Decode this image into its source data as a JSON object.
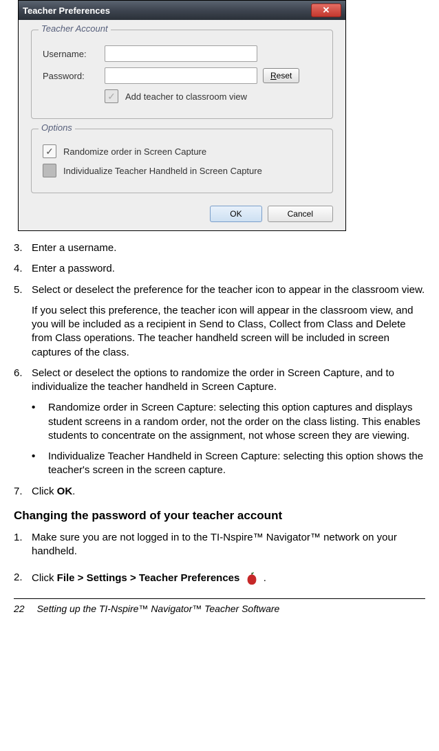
{
  "dialog": {
    "title": "Teacher Preferences",
    "group1": {
      "legend": "Teacher Account",
      "username_label": "Username:",
      "password_label": "Password:",
      "reset_label": "Reset",
      "add_teacher_label": "Add teacher to classroom view"
    },
    "group2": {
      "legend": "Options",
      "opt1": "Randomize order in Screen Capture",
      "opt2": "Individualize Teacher Handheld in Screen Capture"
    },
    "ok": "OK",
    "cancel": "Cancel"
  },
  "steps": {
    "s3": {
      "n": "3.",
      "t": "Enter a username."
    },
    "s4": {
      "n": "4.",
      "t": "Enter a password."
    },
    "s5": {
      "n": "5.",
      "t": "Select or deselect the preference for the teacher icon to appear in the classroom view."
    },
    "s5a": "If you select this preference, the teacher icon will appear in the classroom view, and you will be included as a recipient in Send to Class, Collect from Class and Delete from Class operations. The teacher handheld screen will be included in screen captures of the class.",
    "s6": {
      "n": "6.",
      "t": "Select or deselect the options to randomize the order in Screen Capture, and to individualize the teacher handheld in Screen Capture."
    },
    "b1": "Randomize order in Screen Capture: selecting this option captures and displays student screens in a random order, not the order on the class listing. This enables students to concentrate on the assignment, not whose screen they are viewing.",
    "b2": "Individualize Teacher Handheld in Screen Capture: selecting this option shows the teacher's screen in the screen capture.",
    "s7": {
      "n": "7.",
      "pre": "Click ",
      "bold": "OK",
      "post": "."
    }
  },
  "heading": "Changing the password of your teacher account",
  "steps2": {
    "s1": {
      "n": "1.",
      "t": "Make sure you are not logged in to the TI-Nspire™ Navigator™ network on your handheld."
    },
    "s2": {
      "n": "2.",
      "pre": "Click ",
      "bold": "File > Settings > Teacher Preferences",
      "post": " ."
    }
  },
  "footer": {
    "page": "22",
    "title": "Setting up the TI-Nspire™ Navigator™ Teacher Software"
  }
}
